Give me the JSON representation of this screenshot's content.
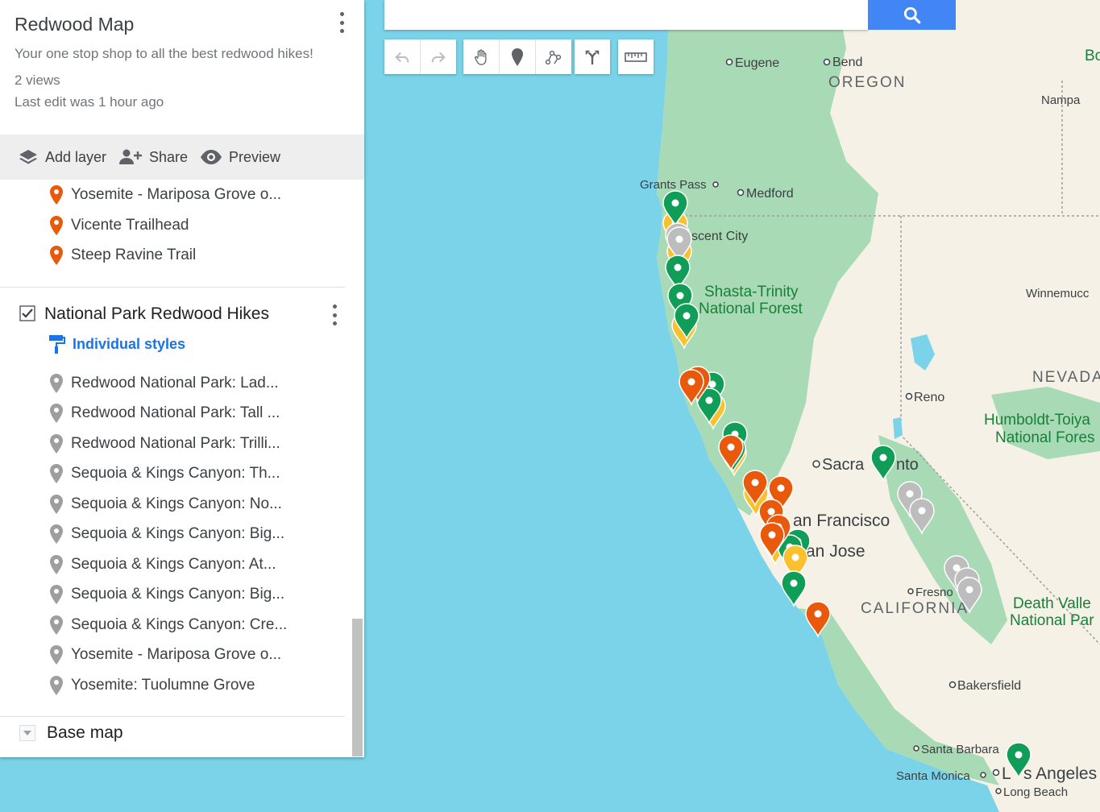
{
  "panel": {
    "title": "Redwood Map",
    "description": "Your one stop shop to all the best redwood hikes!",
    "views": "2 views",
    "last_edit": "Last edit was 1 hour ago"
  },
  "toolbar": {
    "add_layer": "Add layer",
    "share": "Share",
    "preview": "Preview"
  },
  "layer1": {
    "items": [
      "Yosemite - Mariposa Grove o...",
      "Vicente Trailhead",
      "Steep Ravine Trail"
    ],
    "pin_color": "#e8590c"
  },
  "layer2": {
    "title": "National Park Redwood Hikes",
    "style_link": "Individual styles",
    "checked": true,
    "pin_color": "#9e9e9e",
    "items": [
      "Redwood National Park: Lad...",
      "Redwood National Park: Tall ...",
      "Redwood National Park: Trilli...",
      "Sequoia & Kings Canyon: Th...",
      "Sequoia & Kings Canyon: No...",
      "Sequoia & Kings Canyon: Big...",
      "Sequoia & Kings Canyon: At...",
      "Sequoia & Kings Canyon: Big...",
      "Sequoia & Kings Canyon: Cre...",
      "Yosemite - Mariposa Grove o...",
      "Yosemite: Tuolumne Grove"
    ]
  },
  "basemap": {
    "label": "Base map"
  },
  "map": {
    "labels": {
      "eugene": "Eugene",
      "bend": "Bend",
      "oregon": "OREGON",
      "nampa": "Nampa",
      "bo": "Bo",
      "grants_pass": "Grants Pass",
      "medford": "Medford",
      "crescent_city": "scent City",
      "shasta1": "Shasta-Trinity",
      "shasta2": "National Forest",
      "winnemucca": "Winnemucc",
      "nevada": "NEVADA",
      "reno": "Reno",
      "humboldt1": "Humboldt-Toiya",
      "humboldt2": "National Fores",
      "sacramento": "Sacra",
      "sacramento_tail": "nto",
      "sanfrancisco": "an Francisco",
      "sanjose": "an Jose",
      "fresno": "Fresno",
      "california": "CALIFORNIA",
      "deathvalley1": "Death Valle",
      "deathvalley2": "National Par",
      "bakersfield": "Bakersfield",
      "santabarbara": "Santa Barbara",
      "santamonica": "Santa Monica",
      "la_a": "L",
      "la_b": "s Angeles",
      "longbeach": "Long Beach"
    },
    "colors": {
      "water": "#7ad3e8",
      "land": "#f5f1e6",
      "forest": "#a8dab5",
      "pin_green": "#0f9d58",
      "pin_orange": "#e8590c",
      "pin_gray": "#bdbdbd",
      "pin_yellow": "#fbc02d"
    }
  }
}
